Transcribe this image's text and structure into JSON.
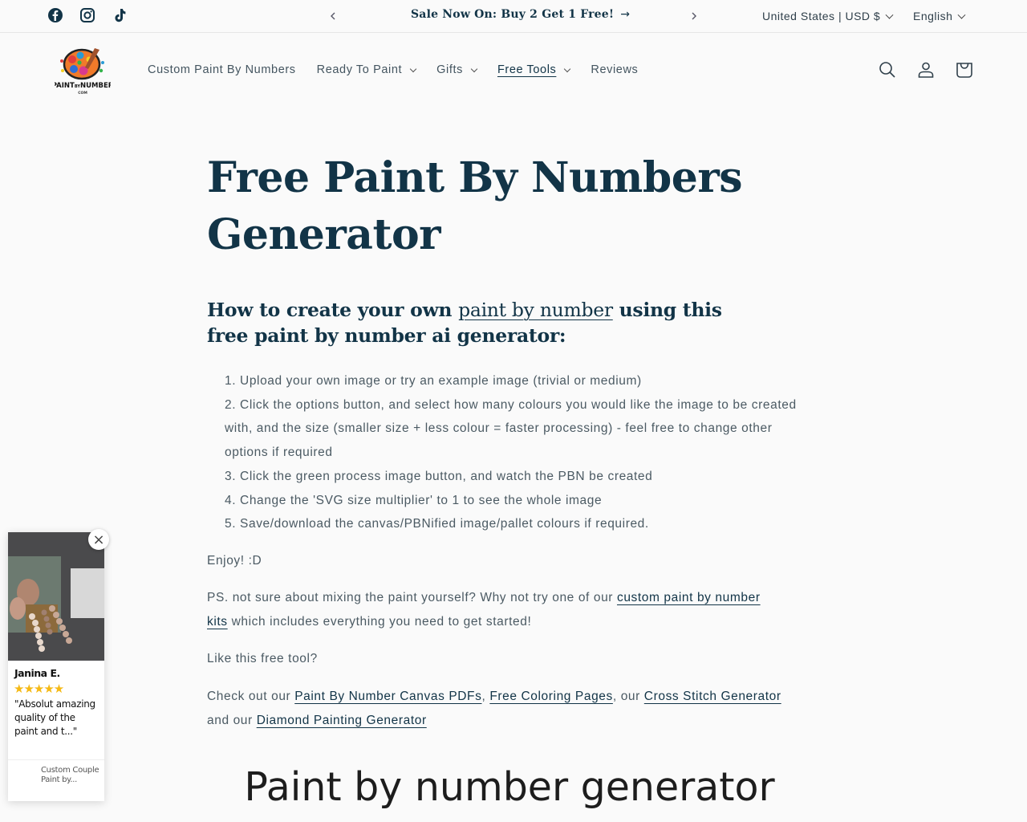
{
  "announcement": {
    "social": [
      "facebook-icon",
      "instagram-icon",
      "tiktok-icon"
    ],
    "message": "Sale Now On: Buy 2 Get 1 Free!",
    "arrow": "→",
    "country_selector": "United States | USD $",
    "language_selector": "English"
  },
  "header": {
    "logo_alt": "PaintByNumber.com",
    "nav": [
      {
        "label": "Custom Paint By Numbers",
        "dropdown": false
      },
      {
        "label": "Ready To Paint",
        "dropdown": true
      },
      {
        "label": "Gifts",
        "dropdown": true
      },
      {
        "label": "Free Tools",
        "dropdown": true,
        "active": true
      },
      {
        "label": "Reviews",
        "dropdown": false
      }
    ],
    "icons": [
      "search-icon",
      "account-icon",
      "cart-icon"
    ]
  },
  "main": {
    "title": "Free Paint By Numbers Generator",
    "howto": {
      "prefix": "How to  create your own ",
      "link": "paint by number",
      "suffix": " using this free  paint by number ai generator:"
    },
    "steps": [
      "1. Upload your own image or try an example image (trivial or medium)",
      "2. Click the options button, and select how many colours you would like the image to be created with, and the size (smaller size + less colour = faster processing) - feel free to change other options if required",
      "3. Click the green process image button, and watch the PBN be created",
      "4. Change the 'SVG size multiplier' to 1 to see the whole image",
      "5. Save/download the canvas/PBNified image/pallet colours if required."
    ],
    "enjoy": "Enjoy! :D",
    "ps": {
      "prefix": "PS. not sure about mixing the paint yourself? Why not try one of our ",
      "link": "custom paint by number kits",
      "suffix": " which includes everything you need to get started!"
    },
    "like": "Like this free tool?",
    "check": {
      "t1": "Check out our ",
      "link1": "Paint By Number Canvas PDFs",
      "t2": ", ",
      "link2": "Free Coloring Pages",
      "t3": ", our ",
      "link3": "Cross Stitch Generator",
      "t4": " and our ",
      "link4": "Diamond Painting Generator"
    },
    "generator_title": "Paint by number generator"
  },
  "review_popup": {
    "close": "×",
    "name": "Janina E.",
    "rating": 5,
    "stars": "★★★★★",
    "quote": "\"Absolut amazing quality of the paint and t...\"",
    "product": "Custom Couple Paint by..."
  }
}
